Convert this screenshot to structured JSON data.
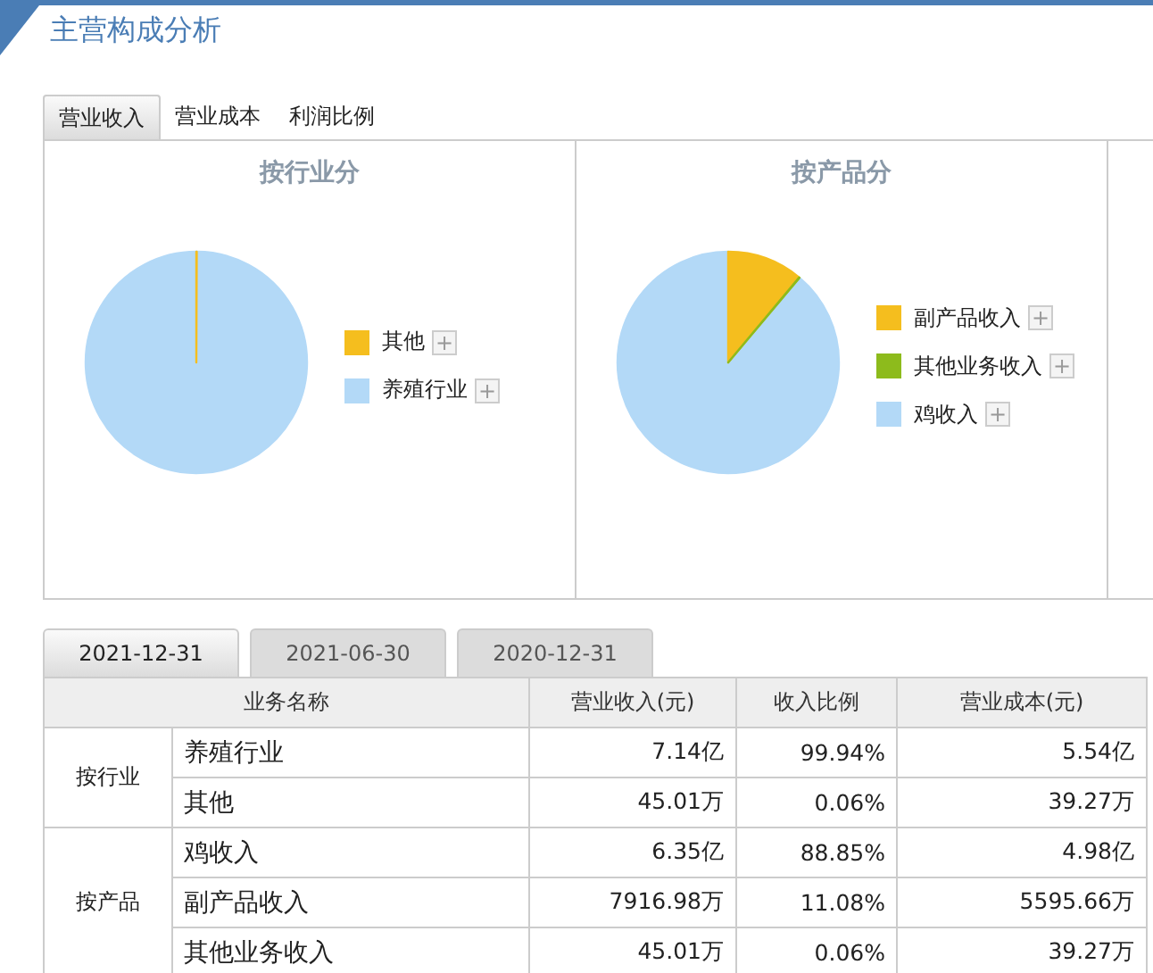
{
  "header": {
    "title": "主营构成分析"
  },
  "tabs": [
    {
      "label": "营业收入",
      "selected": true
    },
    {
      "label": "营业成本",
      "selected": false
    },
    {
      "label": "利润比例",
      "selected": false
    }
  ],
  "charts": [
    {
      "title": "按行业分",
      "legend": [
        {
          "color": "#f5be1e"
        },
        {
          "color": "#b3d9f7"
        }
      ],
      "chart_data": {
        "type": "pie",
        "categories": [
          "其他",
          "养殖行业"
        ],
        "values": [
          0.06,
          99.94
        ]
      }
    },
    {
      "title": "按产品分",
      "legend": [
        {
          "color": "#f5be1e"
        },
        {
          "color": "#8dbb1c"
        },
        {
          "color": "#b3d9f7"
        }
      ],
      "chart_data": {
        "type": "pie",
        "categories": [
          "副产品收入",
          "其他业务收入",
          "鸡收入"
        ],
        "values": [
          11.08,
          0.06,
          88.85
        ]
      }
    }
  ],
  "legend_button": "+",
  "period_tabs": [
    {
      "label": "2021-12-31",
      "selected": true
    },
    {
      "label": "2021-06-30",
      "selected": false
    },
    {
      "label": "2020-12-31",
      "selected": false
    }
  ],
  "table": {
    "columns": [
      "业务名称",
      "营业收入(元)",
      "收入比例",
      "营业成本(元)"
    ],
    "groups": [
      {
        "name": "按行业",
        "rows": [
          [
            "养殖行业",
            "7.14亿",
            "99.94%",
            "5.54亿"
          ],
          [
            "其他",
            "45.01万",
            "0.06%",
            "39.27万"
          ]
        ]
      },
      {
        "name": "按产品",
        "rows": [
          [
            "鸡收入",
            "6.35亿",
            "88.85%",
            "4.98亿"
          ],
          [
            "副产品收入",
            "7916.98万",
            "11.08%",
            "5595.66万"
          ],
          [
            "其他业务收入",
            "45.01万",
            "0.06%",
            "39.27万"
          ]
        ]
      }
    ]
  }
}
